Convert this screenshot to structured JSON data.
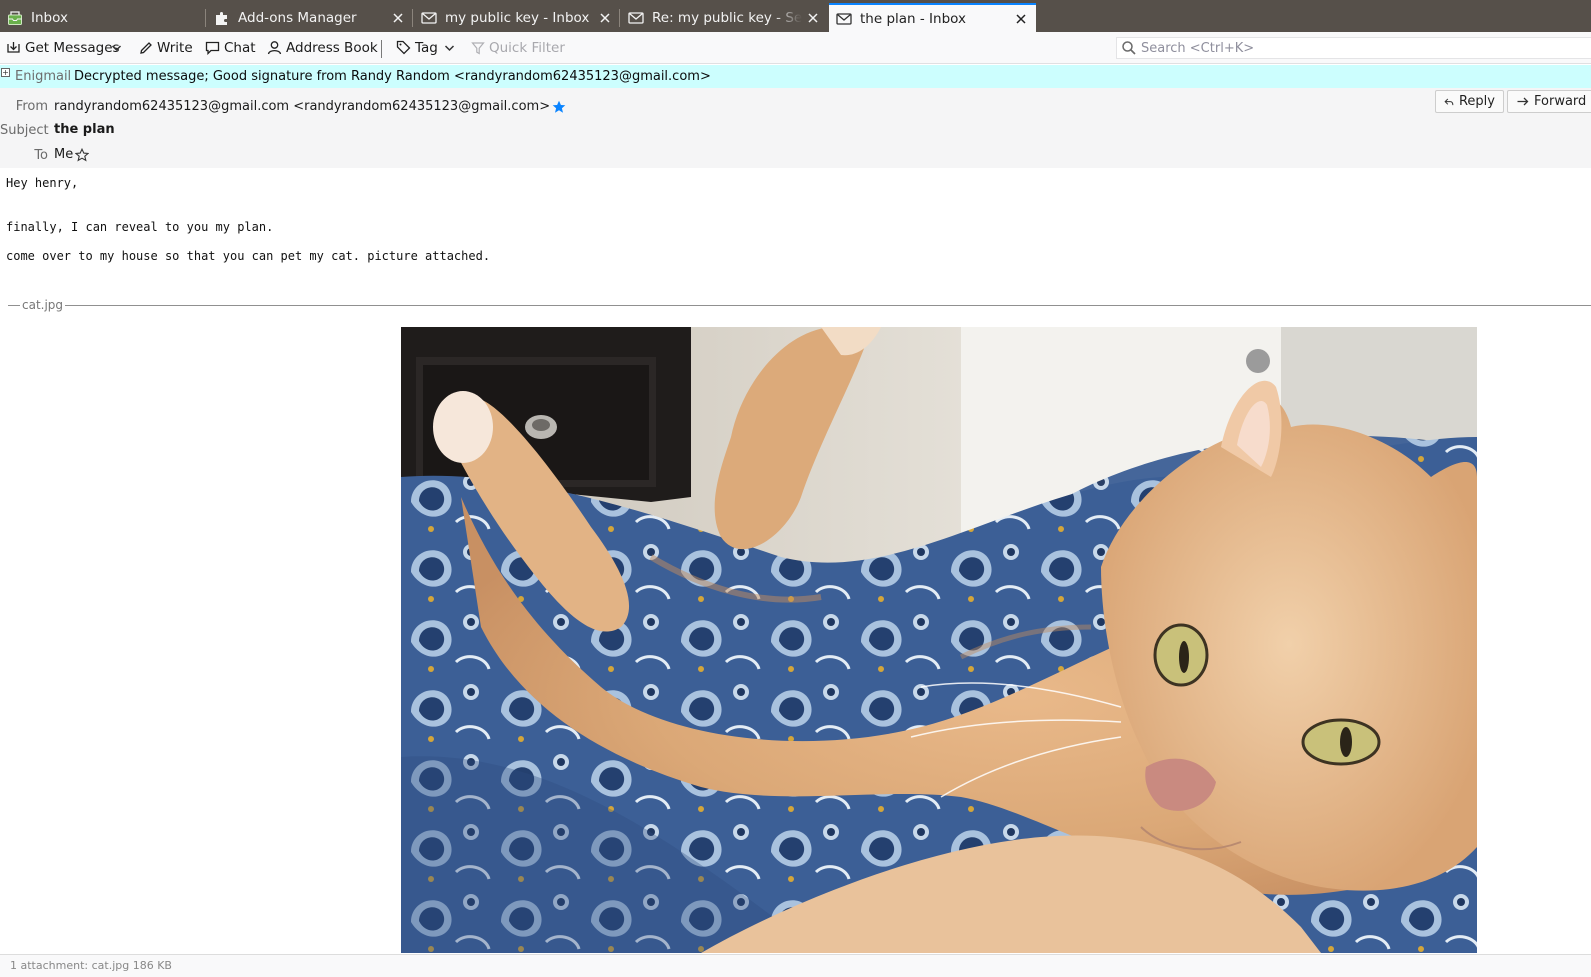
{
  "tabs": [
    {
      "label": "Inbox",
      "icon": "mail-folder-icon",
      "closable": false,
      "selected": false
    },
    {
      "label": "Add-ons Manager",
      "icon": "puzzle-icon",
      "closable": true,
      "selected": false
    },
    {
      "label": "my public key - Inbox",
      "icon": "envelope-icon",
      "closable": true,
      "selected": false
    },
    {
      "label": "Re: my public key - Sent",
      "icon": "envelope-icon",
      "closable": true,
      "selected": false
    },
    {
      "label": "the plan - Inbox",
      "icon": "envelope-icon",
      "closable": true,
      "selected": true
    }
  ],
  "toolbar": {
    "get_messages": "Get Messages",
    "write": "Write",
    "chat": "Chat",
    "address_book": "Address Book",
    "tag": "Tag",
    "quick_filter": "Quick Filter",
    "search_placeholder": "Search <Ctrl+K>"
  },
  "enigmail": {
    "label": "Enigmail",
    "status": "Decrypted message; Good signature from Randy Random <randyrandom62435123@gmail.com>",
    "color": "#ccfefe"
  },
  "headers": {
    "from_label": "From",
    "from_value": "randyrandom62435123@gmail.com <randyrandom62435123@gmail.com>",
    "subject_label": "Subject",
    "subject_value": "the plan",
    "to_label": "To",
    "to_value": "Me",
    "reply": "Reply",
    "forward": "Forward"
  },
  "body": {
    "line1": "Hey henry,",
    "line2": "finally, I can reveal to you my plan.",
    "line3": "come over to my house so that you can pet my cat. picture attached."
  },
  "attachment": {
    "name": "cat.jpg"
  },
  "status_bar": {
    "text": "1 attachment: cat.jpg 186 KB"
  },
  "colors": {
    "tabbar": "#56504a",
    "selected_tab_accent": "#0a84ff",
    "star_blue": "#0a84ff"
  }
}
